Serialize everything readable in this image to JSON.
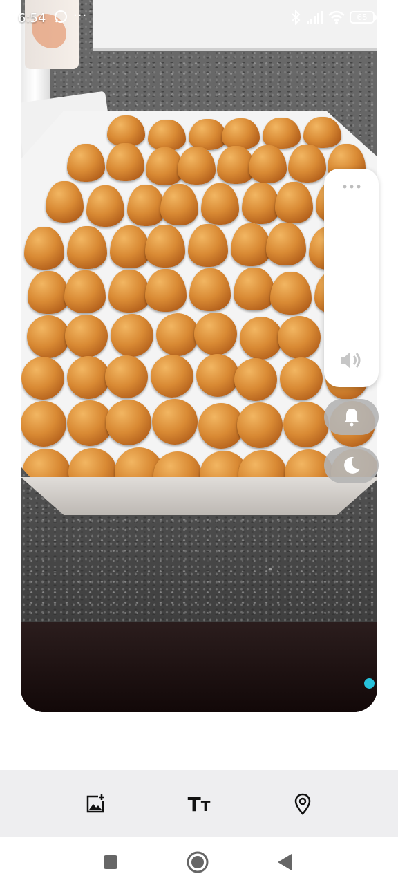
{
  "status_bar": {
    "time": "6:54",
    "more_indicator": "···",
    "battery_level": "65",
    "icons": [
      "whatsapp-icon",
      "bluetooth-icon",
      "signal-icon",
      "wifi-icon",
      "battery-icon"
    ]
  },
  "volume_panel": {
    "icons": [
      "more-options-icon",
      "speaker-icon",
      "bell-icon",
      "moon-icon"
    ]
  },
  "editor_toolbar": {
    "text_tool_big": "T",
    "text_tool_small": "T",
    "icons": [
      "add-image-icon",
      "text-icon",
      "location-pin-icon"
    ]
  },
  "navigation_bar": {
    "icons": [
      "recent-apps-icon",
      "home-icon",
      "back-icon"
    ]
  },
  "colors": {
    "accent_dot": "#27c1da",
    "toolbar_bg": "#eeeef0"
  }
}
